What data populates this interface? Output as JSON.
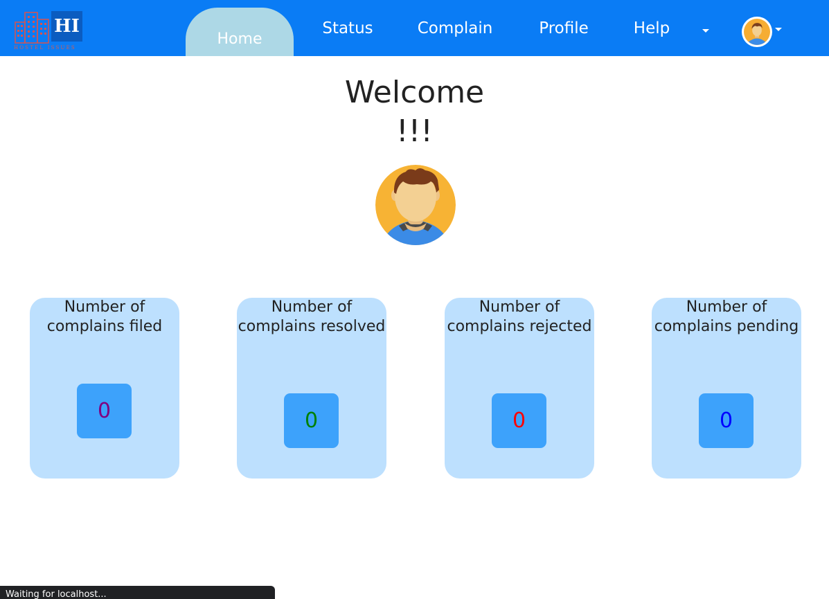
{
  "brand": {
    "logo_initials": "HI",
    "logo_subtitle": "HOSTEL ISSUES",
    "navbar_color": "#0a7cf5",
    "active_tab_color": "#add8e6"
  },
  "nav": {
    "items": [
      {
        "label": "Home",
        "active": true
      },
      {
        "label": "Status"
      },
      {
        "label": "Complain"
      },
      {
        "label": "Profile"
      },
      {
        "label": "Help"
      }
    ],
    "help_dropdown_icon": "caret-down-icon",
    "user_menu_icon": "avatar-icon"
  },
  "welcome": {
    "line1": "Welcome",
    "line2": "!!!"
  },
  "stats": [
    {
      "title": "Number of complains filed",
      "value": "0",
      "value_color": "#800080"
    },
    {
      "title": "Number of complains resolved",
      "value": "0",
      "value_color": "#008000"
    },
    {
      "title": "Number of complains rejected",
      "value": "0",
      "value_color": "#ff0000"
    },
    {
      "title": "Number of complains pending",
      "value": "0",
      "value_color": "#0000ff"
    }
  ],
  "browser_status": "Waiting for localhost..."
}
